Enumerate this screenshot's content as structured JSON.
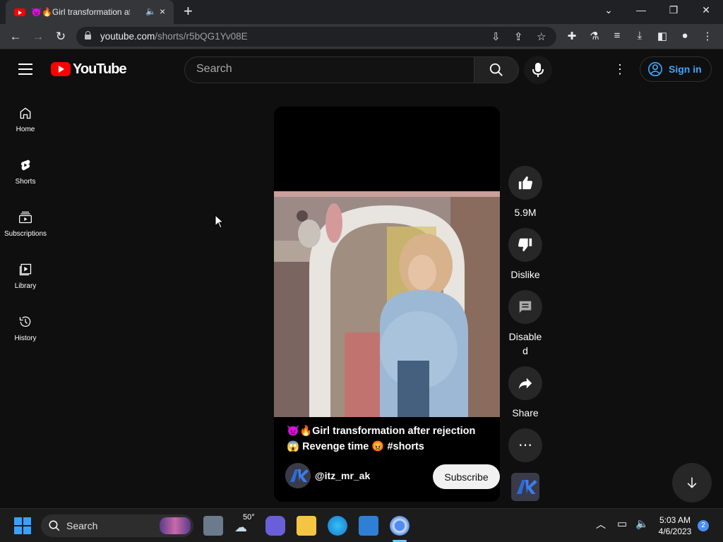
{
  "browser": {
    "tab_title": "👿🔥Girl transformation afte",
    "tab_close": "×",
    "new_tab": "+",
    "url_host": "youtube.com",
    "url_path": "/shorts/r5bQG1Yv08E"
  },
  "header": {
    "logo_text": "YouTube",
    "search_placeholder": "Search",
    "sign_in": "Sign in"
  },
  "sidebar": {
    "items": [
      {
        "label": "Home",
        "icon": "home-icon"
      },
      {
        "label": "Shorts",
        "icon": "shorts-icon"
      },
      {
        "label": "Subscriptions",
        "icon": "subscriptions-icon"
      },
      {
        "label": "Library",
        "icon": "library-icon"
      },
      {
        "label": "History",
        "icon": "history-icon"
      }
    ]
  },
  "short": {
    "caption_line1": "👿🔥Girl transformation after rejection",
    "caption_line2": "😱 Revenge time 😡 #shorts",
    "channel": "@itz_mr_ak",
    "subscribe": "Subscribe"
  },
  "actions": {
    "likes": "5.9M",
    "dislike": "Dislike",
    "comments": "Disabled",
    "share": "Share"
  },
  "taskbar": {
    "search": "Search",
    "weather": "50°",
    "time": "5:03 AM",
    "date": "4/6/2023",
    "notifications": "2"
  },
  "colors": {
    "youtube_red": "#ff0000",
    "link_blue": "#3ea6ff",
    "background": "#0f0f0f"
  }
}
